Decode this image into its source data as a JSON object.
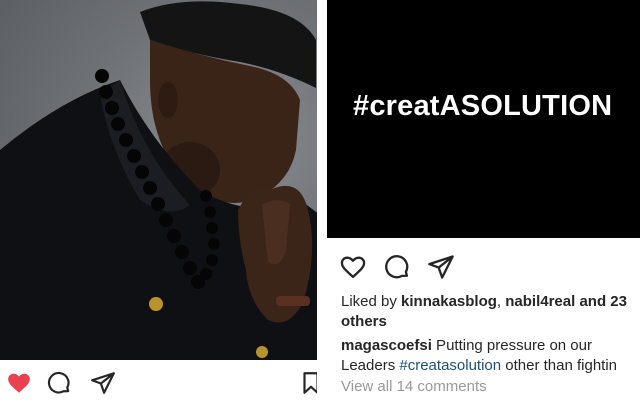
{
  "left_post": {
    "image_description_icon": "person-photo",
    "actions": {
      "like_icon": "heart-filled-icon",
      "comment_icon": "comment-icon",
      "share_icon": "paper-plane-icon",
      "save_icon": "bookmark-icon",
      "like_color": "#e8414f"
    }
  },
  "right_post": {
    "image_text": "#creatASOLUTION",
    "actions": {
      "like_icon": "heart-outline-icon",
      "comment_icon": "comment-icon",
      "share_icon": "paper-plane-icon"
    },
    "likes": {
      "prefix": "Liked by ",
      "user1": "kinnakasblog",
      "separator": ", ",
      "user2": "nabil4real",
      "middle": " and 23",
      "suffix": "others"
    },
    "caption": {
      "username": "magascoefsi",
      "text1": " Putting pressure on our",
      "text2_prefix": "Leaders ",
      "hashtag": "#creatasolution",
      "text2_suffix": " other than fightin"
    },
    "view_comments": "View all 14 comments",
    "hashtag_color": "#1f4f7a"
  }
}
